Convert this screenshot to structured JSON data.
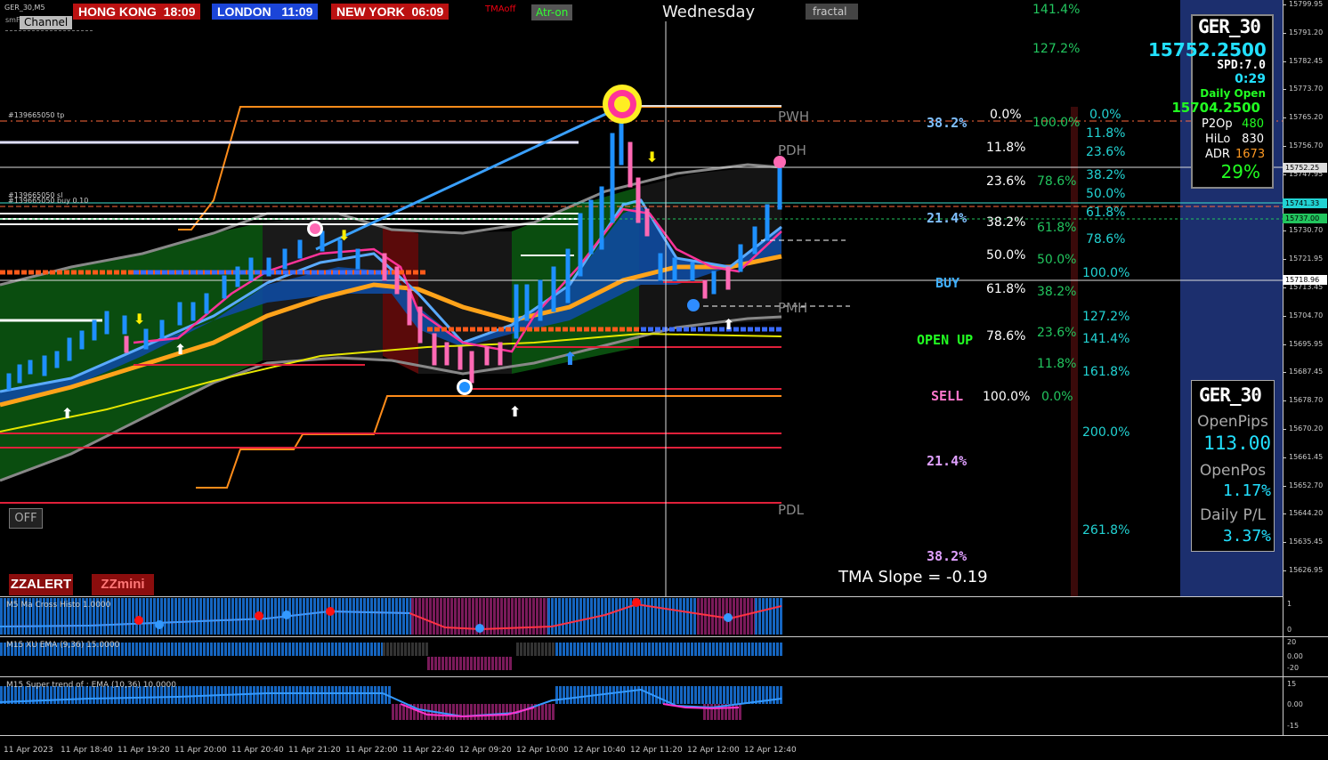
{
  "window": {
    "symbol": "GER_30,M5",
    "sub_indicator_tag": "smF...  4 BT"
  },
  "clocks": [
    {
      "city": "HONG KONG",
      "time": "18:09"
    },
    {
      "city": "LONDON",
      "time": "11:09"
    },
    {
      "city": "NEW YORK",
      "time": "06:09"
    }
  ],
  "toolbar": {
    "tma_label": "TMAoff",
    "atr_label": "Atr-on",
    "day_label": "Wednesday",
    "fractal_label": "fractal",
    "channel_label": "Channel",
    "off_button": "OFF",
    "zzalert_button": "ZZALERT",
    "zzmini_button": "ZZmini"
  },
  "order_labels": {
    "tp": "#139665050 tp",
    "sl": "#139665050 sl",
    "buy": "#139665050 buy 0.10"
  },
  "levels": {
    "pwh": "PWH",
    "pdh": "PDH",
    "pmh": "PMH",
    "pdl": "PDL",
    "buy": "BUY",
    "open_up": "OPEN UP",
    "sell": "SELL",
    "pct_382_top": "38.2%",
    "pct_214_top": "21.4%",
    "pct_214_low": "21.4%",
    "pct_382_low": "38.2%",
    "tma_slope": "TMA Slope = -0.19"
  },
  "fib_white": [
    "0.0%",
    "11.8%",
    "23.6%",
    "38.2%",
    "50.0%",
    "61.8%",
    "78.6%",
    "100.0%"
  ],
  "fib_green_top": [
    "141.4%",
    "127.2%"
  ],
  "fib_green": [
    "100.0%",
    "78.6%",
    "61.8%",
    "50.0%",
    "38.2%",
    "23.6%",
    "11.8%",
    "0.0%"
  ],
  "fib_cyan": [
    "0.0%",
    "11.8%",
    "23.6%",
    "38.2%",
    "50.0%",
    "61.8%",
    "78.6%",
    "100.0%",
    "127.2%",
    "141.4%",
    "161.8%",
    "200.0%",
    "261.8%"
  ],
  "info_panel": {
    "symbol": "GER_30",
    "price": "15752.2500",
    "spread": "SPD:7.0",
    "timer": "0:29",
    "daily_open_label": "Daily Open",
    "daily_open_value": "15704.2500",
    "p2op_label": "P2Op",
    "p2op_value": "480",
    "hilo_label": "HiLo",
    "hilo_value": "830",
    "adr_label": "ADR",
    "adr_value": "1673",
    "percent": "29%"
  },
  "positions_panel": {
    "symbol": "GER_30",
    "open_pips_label": "OpenPips",
    "open_pips_value": "113.00",
    "open_pos_label": "OpenPos",
    "open_pos_value": "1.17%",
    "daily_pl_label": "Daily P/L",
    "daily_pl_value": "3.37%"
  },
  "price_axis": [
    "15799.95",
    "15791.20",
    "15782.45",
    "15773.70",
    "15765.20",
    "15756.70",
    "15747.95",
    "15739.20",
    "15730.70",
    "15721.95",
    "15713.45",
    "15704.70",
    "15695.95",
    "15687.45",
    "15678.70",
    "15670.20",
    "15661.45",
    "15652.70",
    "15644.20",
    "15635.45",
    "15626.95"
  ],
  "price_tags": {
    "current": "15752.25",
    "line_a": "15741.33",
    "line_b": "15737.00",
    "line_c": "15718.96"
  },
  "subwindows": {
    "ma_cross": {
      "label": "M5 Ma Cross Histo 1.0000",
      "axis": [
        "1",
        "0"
      ]
    },
    "xu_ema": {
      "label": "M15 XU EMA (9,36) 15.0000",
      "axis": [
        "20",
        "0.00",
        "-20"
      ]
    },
    "supertrend": {
      "label": "M15  Super trend of : EMA (10,36)  10.0000",
      "axis": [
        "15",
        "0.00",
        "-15"
      ]
    }
  },
  "time_axis": [
    "11 Apr 2023",
    "11 Apr 18:40",
    "11 Apr 19:20",
    "11 Apr 20:00",
    "11 Apr 20:40",
    "11 Apr 21:20",
    "11 Apr 22:00",
    "11 Apr 22:40",
    "12 Apr 09:20",
    "12 Apr 10:00",
    "12 Apr 10:40",
    "12 Apr 11:20",
    "12 Apr 12:00",
    "12 Apr 12:40"
  ],
  "colors": {
    "bull": "#1e90ff",
    "bear": "#ff69b4",
    "panel_bg": "#1c2f6e",
    "fib_green": "#22c55e",
    "fib_cyan": "#22d3d3"
  }
}
